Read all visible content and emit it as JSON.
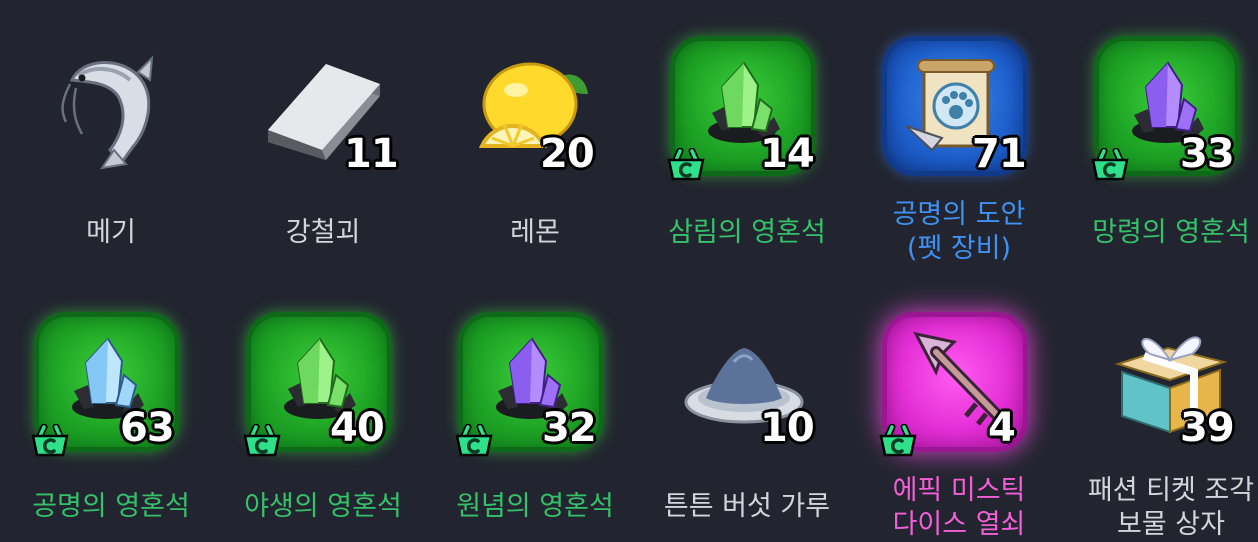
{
  "items": [
    {
      "name": "메기",
      "count": "",
      "icon": "catfish-icon",
      "rarity": "none",
      "label_color": "#d3d5da",
      "basket": false
    },
    {
      "name": "강철괴",
      "count": "11",
      "icon": "steel-ingot-icon",
      "rarity": "none",
      "label_color": "#d3d5da",
      "basket": false
    },
    {
      "name": "레몬",
      "count": "20",
      "icon": "lemon-icon",
      "rarity": "none",
      "label_color": "#d3d5da",
      "basket": false
    },
    {
      "name": "삼림의 영혼석",
      "count": "14",
      "icon": "forest-soulstone-icon",
      "rarity": "green",
      "label_color": "#35c16a",
      "basket": true
    },
    {
      "name": "공명의 도안",
      "name_line2": "(펫 장비)",
      "count": "71",
      "icon": "paw-blueprint-scroll-icon",
      "rarity": "blue",
      "label_color": "#3f91f2",
      "basket": false
    },
    {
      "name": "망령의 영혼석",
      "count": "33",
      "icon": "wraith-soulstone-icon",
      "rarity": "green",
      "label_color": "#35c16a",
      "basket": true
    },
    {
      "name": "공명의 영혼석",
      "count": "63",
      "icon": "resonance-soulstone-icon",
      "rarity": "green",
      "label_color": "#35c16a",
      "basket": true
    },
    {
      "name": "야생의 영혼석",
      "count": "40",
      "icon": "wild-soulstone-icon",
      "rarity": "green",
      "label_color": "#35c16a",
      "basket": true
    },
    {
      "name": "원념의 영혼석",
      "count": "32",
      "icon": "grudge-soulstone-icon",
      "rarity": "green",
      "label_color": "#35c16a",
      "basket": true
    },
    {
      "name": "튼튼 버섯 가루",
      "count": "10",
      "icon": "mushroom-powder-icon",
      "rarity": "none",
      "label_color": "#d3d5da",
      "basket": false
    },
    {
      "name": "에픽 미스틱",
      "name_line2": "다이스 열쇠",
      "count": "4",
      "icon": "mystic-dice-key-icon",
      "rarity": "pink",
      "label_color": "#f25fd6",
      "basket": true
    },
    {
      "name": "패션 티켓 조각",
      "name_line2": "보물 상자",
      "count": "39",
      "icon": "gift-box-icon",
      "rarity": "none",
      "label_color": "#d3d5da",
      "basket": false
    }
  ]
}
